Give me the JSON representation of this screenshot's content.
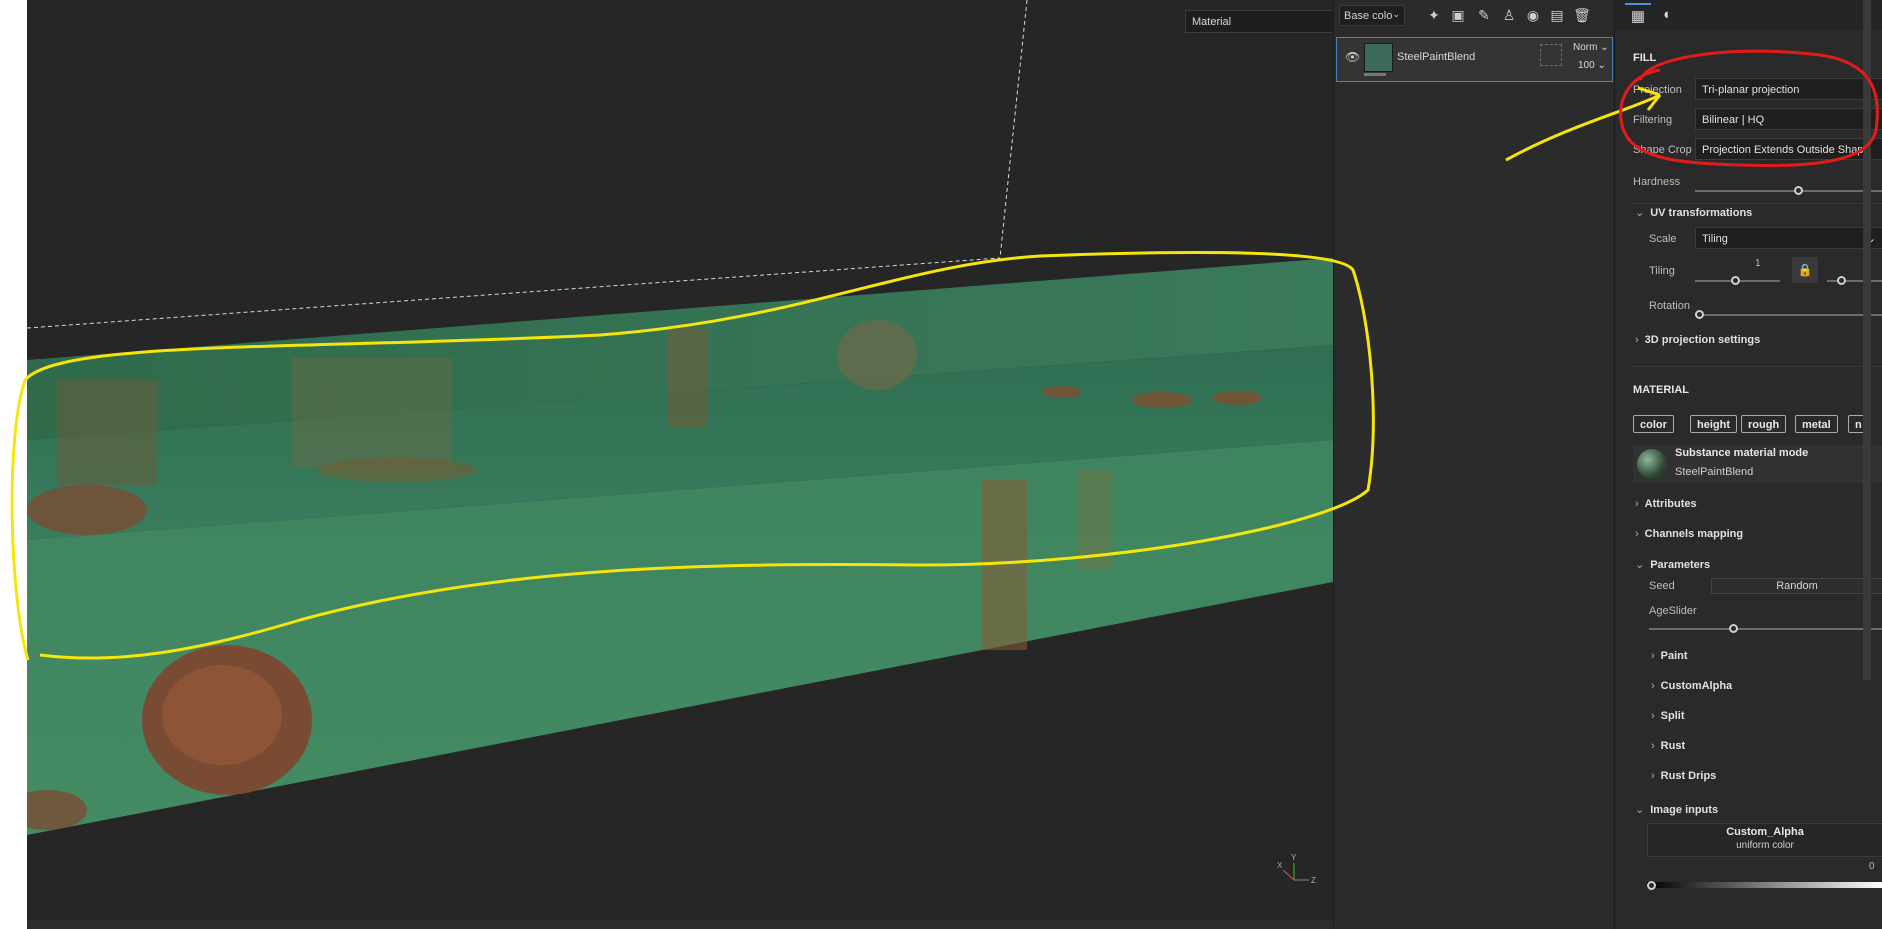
{
  "viewport": {
    "mode_select": "Material"
  },
  "layers": {
    "channel_select": "Base colo",
    "layer": {
      "name": "SteelPaintBlend",
      "blend_mode": "Norm",
      "opacity": "100"
    }
  },
  "properties": {
    "fill_title": "FILL",
    "projection_label": "Projection",
    "projection_value": "Tri-planar projection",
    "filtering_label": "Filtering",
    "filtering_value": "Bilinear | HQ",
    "shape_crop_label": "Shape Crop",
    "shape_crop_value": "Projection Extends Outside Shape",
    "hardness_label": "Hardness",
    "hardness_level": 0.55,
    "uv_title": "UV transformations",
    "scale_label": "Scale",
    "scale_value": "Tiling",
    "tiling_label": "Tiling",
    "tiling_value": "1",
    "rotation_label": "Rotation",
    "projection3d_title": "3D projection settings",
    "material_title": "MATERIAL",
    "chips": [
      "color",
      "height",
      "rough",
      "metal",
      "n"
    ],
    "material_mode": "Substance material mode",
    "material_name": "SteelPaintBlend",
    "attributes_title": "Attributes",
    "channels_mapping_title": "Channels mapping",
    "parameters_title": "Parameters",
    "seed_label": "Seed",
    "seed_button": "Random",
    "age_label": "AgeSlider",
    "groups": [
      "Paint",
      "CustomAlpha",
      "Split",
      "Rust",
      "Rust Drips"
    ],
    "image_inputs_title": "Image inputs",
    "custom_alpha_name": "Custom_Alpha",
    "custom_alpha_value": "uniform color",
    "custom_alpha_number": "0"
  },
  "colors": {
    "annotation_yellow": "#f5e50a",
    "annotation_red": "#e11b1b",
    "paint_green": "#3f8a62",
    "rust": "#8a4a2a"
  }
}
